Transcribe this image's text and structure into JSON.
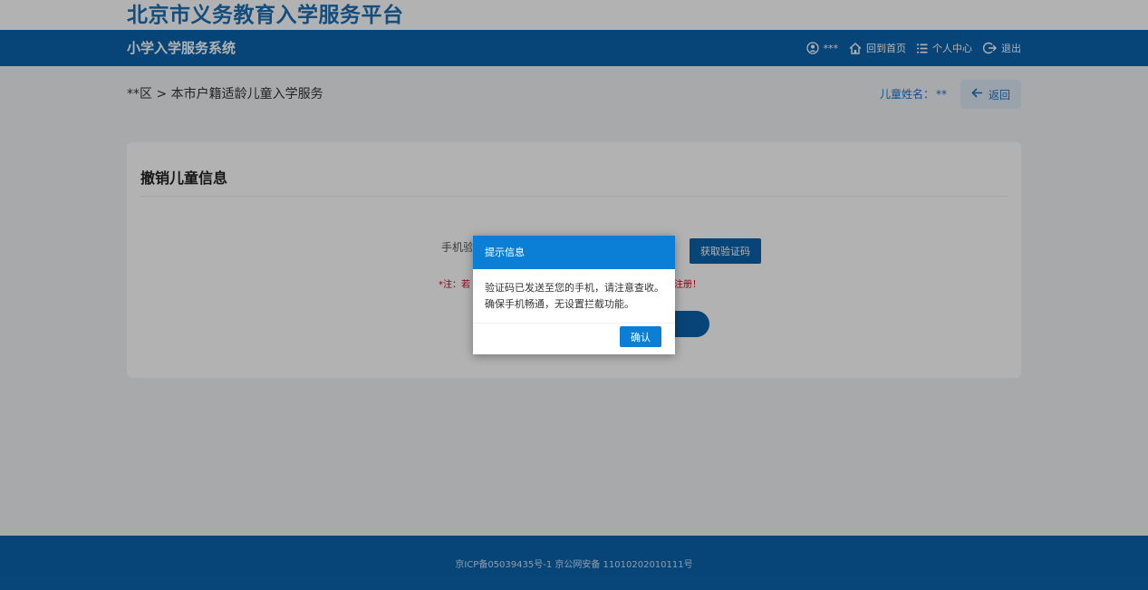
{
  "header": {
    "platform_title": "北京市义务教育入学服务平台",
    "system_title": "小学入学服务系统",
    "user_name": "***",
    "home_label": "回到首页",
    "profile_label": "个人中心",
    "logout_label": "退出"
  },
  "breadcrumb": {
    "text": "**区 > 本市户籍适龄儿童入学服务",
    "child_name_label": "儿童姓名：",
    "child_name_value": "**",
    "back_label": "返回"
  },
  "card": {
    "title": "撤销儿童信息",
    "phone_label": "手机验证码",
    "get_code_label": "获取验证码",
    "note_left": "*注：若",
    "note_right": "注册！"
  },
  "modal": {
    "title": "提示信息",
    "line1": "验证码已发送至您的手机，请注意查收。",
    "line2": "确保手机畅通，无设置拦截功能。",
    "confirm_label": "确认"
  },
  "footer": {
    "text": "京ICP备05039435号-1 京公网安备 11010202010111号"
  },
  "colors": {
    "brand_blue": "#0b63ad",
    "title_blue": "#1a6fb5",
    "modal_blue": "#0b7fd6",
    "note_red": "#d0021b"
  }
}
